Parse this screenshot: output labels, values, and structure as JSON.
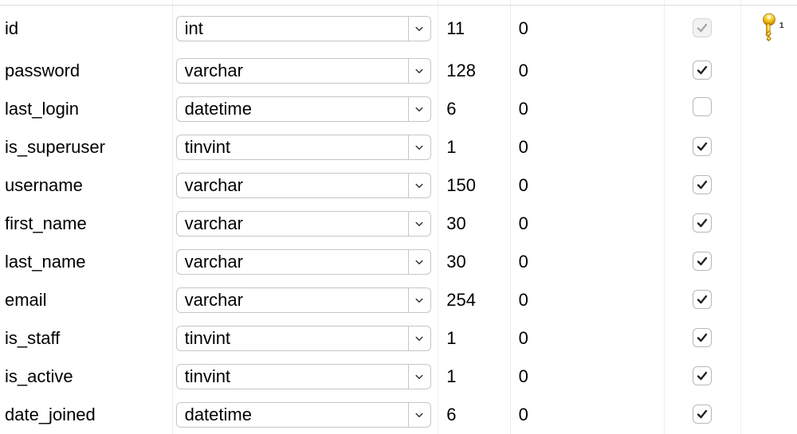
{
  "fields": [
    {
      "name": "id",
      "type": "int",
      "length": "11",
      "decimals": "0",
      "checked": true,
      "disabled": true,
      "is_primary": true,
      "key_label": "1"
    },
    {
      "name": "password",
      "type": "varchar",
      "length": "128",
      "decimals": "0",
      "checked": true,
      "disabled": false,
      "is_primary": false
    },
    {
      "name": "last_login",
      "type": "datetime",
      "length": "6",
      "decimals": "0",
      "checked": false,
      "disabled": false,
      "is_primary": false
    },
    {
      "name": "is_superuser",
      "type": "tinvint",
      "length": "1",
      "decimals": "0",
      "checked": true,
      "disabled": false,
      "is_primary": false
    },
    {
      "name": "username",
      "type": "varchar",
      "length": "150",
      "decimals": "0",
      "checked": true,
      "disabled": false,
      "is_primary": false
    },
    {
      "name": "first_name",
      "type": "varchar",
      "length": "30",
      "decimals": "0",
      "checked": true,
      "disabled": false,
      "is_primary": false
    },
    {
      "name": "last_name",
      "type": "varchar",
      "length": "30",
      "decimals": "0",
      "checked": true,
      "disabled": false,
      "is_primary": false
    },
    {
      "name": "email",
      "type": "varchar",
      "length": "254",
      "decimals": "0",
      "checked": true,
      "disabled": false,
      "is_primary": false
    },
    {
      "name": "is_staff",
      "type": "tinvint",
      "length": "1",
      "decimals": "0",
      "checked": true,
      "disabled": false,
      "is_primary": false
    },
    {
      "name": "is_active",
      "type": "tinvint",
      "length": "1",
      "decimals": "0",
      "checked": true,
      "disabled": false,
      "is_primary": false
    },
    {
      "name": "date_joined",
      "type": "datetime",
      "length": "6",
      "decimals": "0",
      "checked": true,
      "disabled": false,
      "is_primary": false
    }
  ]
}
